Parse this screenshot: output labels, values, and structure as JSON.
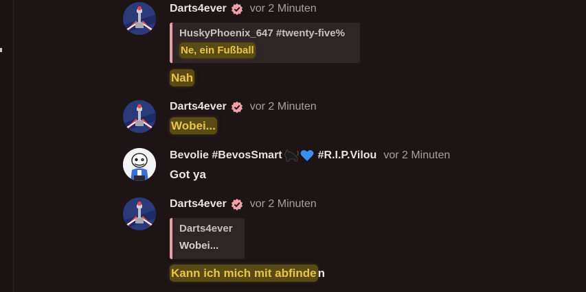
{
  "messages": [
    {
      "username": "Darts4ever",
      "timestamp": "vor 2 Minuten",
      "reply": {
        "author": "HuskyPhoenix_647 #twenty-five%",
        "text": "Ne, ein Fußball"
      },
      "lines": [
        "Nah"
      ]
    },
    {
      "username": "Darts4ever",
      "timestamp": "vor 2 Minuten",
      "lines": [
        "Wobei..."
      ]
    },
    {
      "username_parts": [
        "Bevolie #BevosSmart",
        "#R.I.P.Vilou"
      ],
      "username_emojis": [
        "black-cat",
        "blue-heart"
      ],
      "timestamp": "vor 2 Minuten",
      "lines": [
        "Got ya"
      ]
    },
    {
      "username": "Darts4ever",
      "timestamp": "vor 2 Minuten",
      "reply": {
        "author": "Darts4ever",
        "text": "Wobei..."
      },
      "text_highlighted": "Kann ich mich mit abfinde",
      "text_rest": "n"
    }
  ],
  "colors": {
    "background": "#1c1415",
    "highlight": "#5a4a14",
    "highlight_text": "#e8c54a",
    "reply_bar": "#e9a0a8",
    "verified_badge": "#f0a0a8"
  }
}
